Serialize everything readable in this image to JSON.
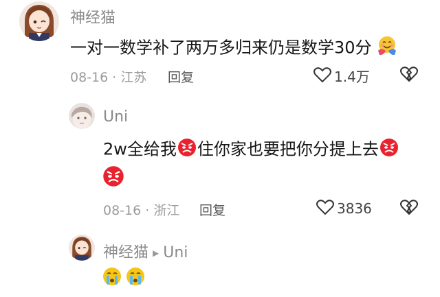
{
  "comments": [
    {
      "username": "神经猫",
      "text": "一对一数学补了两万多归来仍是数学30分",
      "trailing_emoji": "hugging-face-emoji",
      "date_location": "08-16 · 江苏",
      "reply_label": "回复",
      "like_count": "1.4万"
    },
    {
      "username": "Uni",
      "text_parts": [
        "2w全给我",
        "住你家也要把你分提上去"
      ],
      "inline_emoji": "angry-face-emoji",
      "date_location": "08-16 · 浙江",
      "reply_label": "回复",
      "like_count": "3836"
    },
    {
      "username": "神经猫",
      "reply_to": "Uni",
      "emojis": [
        "crying-face-emoji",
        "crying-face-emoji"
      ]
    }
  ],
  "colors": {
    "username": "#8a8a8a",
    "text": "#161616",
    "meta": "#9a9a9a",
    "angry_emoji": "#e8232f",
    "crying_emoji": "#f5c518"
  }
}
